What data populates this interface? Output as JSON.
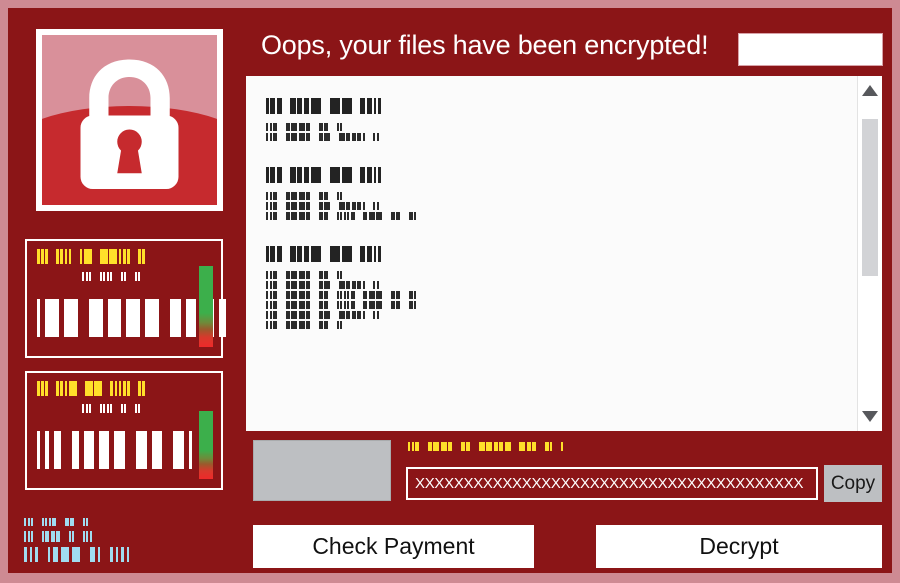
{
  "theme": {
    "frame_border": "#CE8A93",
    "background": "#8B1517",
    "accent_red": "#C62A2E",
    "accent_pink": "#D9909A",
    "note_background": "#FBFBFB",
    "heading_yellow": "#FFE02A",
    "info_blue": "#A0DCF0",
    "gauge_top": "#3CAF4B",
    "gauge_bottom": "#EE2A2A",
    "button_gray": "#BDBFC2"
  },
  "header": {
    "title": "Oops, your files have been encrypted!",
    "language_select_value": ""
  },
  "lock_panel": {
    "icon": "padlock-icon"
  },
  "timer_panels": [
    {
      "name": "payment-deadline",
      "heading_text": "redacted-heading",
      "heading_color": "#FFE02A",
      "subtitle_text": "redacted-subtitle",
      "subtitle_color": "#FFFFFF",
      "countdown_text": "redacted-countdown",
      "countdown_color": "#FFFFFF",
      "gauge": "green-to-red-gauge",
      "heading_bars": [
        1,
        1,
        1,
        1,
        1,
        1,
        1,
        1,
        3,
        3,
        3,
        1,
        1,
        1,
        1,
        1
      ],
      "subtitle_bars": [
        1,
        1,
        1,
        1,
        1,
        1,
        1,
        1,
        1,
        1,
        1
      ],
      "countdown_bars": [
        1,
        4,
        4,
        4,
        4,
        4,
        4,
        3,
        3,
        2,
        2
      ]
    },
    {
      "name": "file-loss-deadline",
      "heading_text": "redacted-heading",
      "heading_color": "#FFE02A",
      "subtitle_text": "redacted-subtitle",
      "subtitle_color": "#FFFFFF",
      "countdown_text": "redacted-countdown",
      "countdown_color": "#FFFFFF",
      "gauge": "green-to-red-gauge",
      "heading_bars": [
        1,
        1,
        1,
        1,
        1,
        1,
        3,
        3,
        3,
        1,
        1,
        1,
        1,
        1,
        1,
        1
      ],
      "subtitle_bars": [
        1,
        1,
        1,
        1,
        1,
        1,
        1,
        1,
        1,
        1,
        1
      ],
      "countdown_bars": [
        1,
        1,
        2,
        2,
        3,
        3,
        3,
        3,
        3,
        3,
        1
      ]
    }
  ],
  "left_info": {
    "color": "#A0DCF0",
    "lines": [
      {
        "name": "info-line-1",
        "text": "redacted-info-small",
        "size": 9,
        "bars": [
          1,
          1,
          1,
          1,
          1,
          1,
          2,
          2,
          2,
          1,
          1
        ]
      },
      {
        "name": "info-line-2",
        "text": "redacted-info-medium",
        "size": 11,
        "bars": [
          1,
          1,
          1,
          1,
          2,
          2,
          2,
          1,
          1,
          1,
          1,
          1
        ]
      },
      {
        "name": "info-line-3",
        "text": "redacted-info-large",
        "size": 15,
        "bars": [
          1,
          1,
          1,
          1,
          2,
          3,
          3,
          2,
          1,
          1,
          1,
          1,
          1
        ]
      }
    ]
  },
  "note": {
    "blocks": [
      {
        "name": "note-block-what-happened",
        "heading": {
          "text": "redacted-heading",
          "bars": [
            1,
            2,
            2,
            2,
            2,
            2,
            4,
            4,
            4,
            2,
            2,
            1,
            1
          ]
        },
        "paragraphs": [
          {
            "text": "redacted-paragraph-line",
            "bars": [
              1,
              1,
              2,
              2,
              3,
              3,
              2,
              2,
              2,
              1,
              1
            ]
          },
          {
            "text": "redacted-paragraph-line",
            "bars": [
              1,
              1,
              2,
              2,
              3,
              3,
              2,
              2,
              3,
              3,
              2,
              2,
              2,
              1,
              1,
              1
            ]
          }
        ]
      },
      {
        "name": "note-block-can-i-recover",
        "heading": {
          "text": "redacted-heading",
          "bars": [
            1,
            2,
            2,
            2,
            2,
            2,
            4,
            4,
            4,
            2,
            2,
            1,
            1
          ]
        },
        "paragraphs": [
          {
            "text": "redacted-paragraph-line",
            "bars": [
              1,
              1,
              2,
              2,
              3,
              3,
              2,
              2,
              2,
              1,
              1
            ]
          },
          {
            "text": "redacted-paragraph-line",
            "bars": [
              1,
              1,
              2,
              2,
              3,
              3,
              2,
              2,
              3,
              3,
              2,
              2,
              2,
              1,
              1,
              1
            ]
          },
          {
            "text": "redacted-paragraph-line",
            "bars": [
              1,
              1,
              2,
              2,
              3,
              3,
              2,
              2,
              2,
              1,
              1,
              1,
              1,
              2,
              2,
              3,
              3,
              2,
              2,
              2,
              1
            ]
          }
        ]
      },
      {
        "name": "note-block-how-do-i-pay",
        "heading": {
          "text": "redacted-heading",
          "bars": [
            1,
            2,
            2,
            2,
            2,
            2,
            4,
            4,
            4,
            2,
            2,
            1,
            1
          ]
        },
        "paragraphs": [
          {
            "text": "redacted-paragraph-line",
            "bars": [
              1,
              1,
              2,
              2,
              3,
              3,
              2,
              2,
              2,
              1,
              1
            ]
          },
          {
            "text": "redacted-paragraph-line",
            "bars": [
              1,
              1,
              2,
              2,
              3,
              3,
              2,
              2,
              3,
              3,
              2,
              2,
              2,
              1,
              1,
              1
            ]
          },
          {
            "text": "redacted-paragraph-line",
            "bars": [
              1,
              1,
              2,
              2,
              3,
              3,
              2,
              2,
              2,
              1,
              1,
              1,
              1,
              2,
              2,
              3,
              3,
              2,
              2,
              2,
              1
            ]
          },
          {
            "text": "redacted-paragraph-line",
            "bars": [
              1,
              1,
              2,
              2,
              3,
              3,
              2,
              2,
              2,
              1,
              1,
              1,
              1,
              2,
              2,
              3,
              3,
              2,
              2,
              2,
              1
            ]
          },
          {
            "text": "redacted-paragraph-line",
            "bars": [
              1,
              1,
              2,
              2,
              3,
              3,
              2,
              2,
              3,
              3,
              2,
              2,
              2,
              1,
              1,
              1
            ]
          },
          {
            "text": "redacted-paragraph-line",
            "bars": [
              1,
              1,
              2,
              2,
              3,
              3,
              2,
              2,
              2,
              1,
              1
            ]
          }
        ]
      }
    ],
    "scrollbar": {
      "up_arrow": "scroll-up-arrow-icon",
      "down_arrow": "scroll-down-arrow-icon",
      "thumb_position_percent": 12,
      "thumb_size_percent": 49
    }
  },
  "payment": {
    "qr_placeholder": "bitcoin-qr-code",
    "address_label": {
      "text": "redacted-address-label",
      "color": "#FFE02A",
      "bars": [
        1,
        1,
        2,
        2,
        3,
        3,
        2,
        2,
        2,
        3,
        3,
        2,
        2,
        3,
        3,
        2,
        2,
        2,
        1,
        1
      ]
    },
    "address_value": "XXXXXXXXXXXXXXXXXXXXXXXXXXXXXXXXXXXXXXXX",
    "copy_label": "Copy"
  },
  "actions": {
    "check_payment_label": "Check Payment",
    "decrypt_label": "Decrypt"
  }
}
